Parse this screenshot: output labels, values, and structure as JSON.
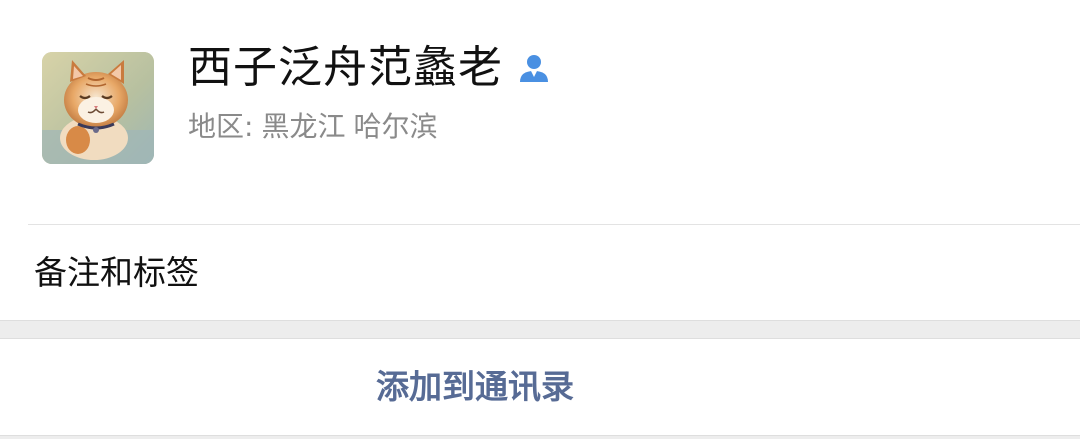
{
  "profile": {
    "nickname": "西子泛舟范蠡老",
    "region_label": "地区:",
    "region_province": "黑龙江",
    "region_city": "哈尔滨",
    "avatar_icon": "cat-avatar",
    "verified_icon": "person-icon",
    "verified_icon_color": "#4a90e2"
  },
  "remark": {
    "label": "备注和标签"
  },
  "action": {
    "add_contact_label": "添加到通讯录",
    "color": "#576b95"
  }
}
